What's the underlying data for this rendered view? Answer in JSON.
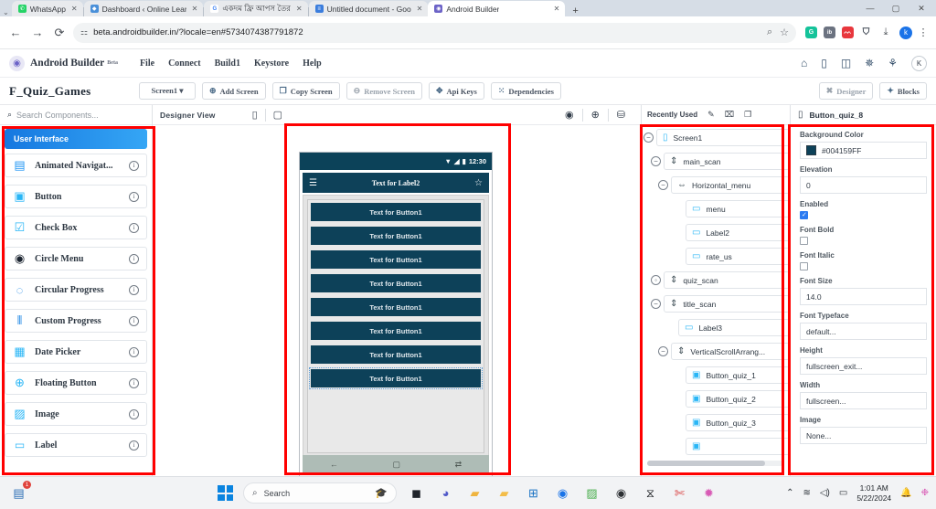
{
  "browser": {
    "tabs": [
      {
        "title": "WhatsApp",
        "favicon": "whatsapp-icon",
        "color": "#25d366",
        "glyph": "✆",
        "active": false
      },
      {
        "title": "Dashboard ‹ Online Learn",
        "favicon": "wordpress-icon",
        "color": "#4a90d9",
        "glyph": "◆",
        "active": false
      },
      {
        "title": "একদম ফ্রি আপস তৈর",
        "favicon": "google-icon",
        "color": "#ffffff",
        "glyph": "G",
        "active": false
      },
      {
        "title": "Untitled document - Goo",
        "favicon": "google-docs-icon",
        "color": "#3b7ddd",
        "glyph": "≡",
        "active": false
      },
      {
        "title": "Android Builder",
        "favicon": "android-builder-icon",
        "color": "#6c63c7",
        "glyph": "◉",
        "active": true
      }
    ],
    "new_tab_label": "+",
    "close_label": "✕",
    "window_controls": {
      "minimize": "—",
      "maximize": "▢",
      "close": "✕"
    },
    "nav": {
      "back": "←",
      "forward": "→",
      "reload": "⟳"
    },
    "url": "beta.androidbuilder.in/?locale=en#5734074387791872",
    "site_icon": "site-settings-icon",
    "zoom_icon": "zoom-icon",
    "bookmark_icon": "star-icon",
    "extensions": [
      {
        "name": "grammarly-extension",
        "glyph": "G",
        "color": "#15c39a"
      },
      {
        "name": "ib-extension",
        "glyph": "ib",
        "color": "#6b7280"
      },
      {
        "name": "chart-extension",
        "glyph": "ᨓ",
        "color": "#e8373d"
      },
      {
        "name": "pocket-extension",
        "glyph": "⛉",
        "color": "#3c4450"
      }
    ],
    "download_icon": "download-icon",
    "profile_initial": "k",
    "menu_icon": "kebab-menu-icon"
  },
  "app": {
    "brand": "Android Builder",
    "brand_badge": "Beta",
    "menu": [
      "File",
      "Connect",
      "Build1",
      "Keystore",
      "Help"
    ],
    "right_icons": [
      {
        "name": "home-icon",
        "glyph": "⌂"
      },
      {
        "name": "phone-icon",
        "glyph": "▯"
      },
      {
        "name": "book-icon",
        "glyph": "◫"
      },
      {
        "name": "bug-icon",
        "glyph": "✵"
      },
      {
        "name": "community-icon",
        "glyph": "⚘"
      }
    ],
    "avatar_initial": "K"
  },
  "toolbar": {
    "project_name": "F_Quiz_Games",
    "screen_selector": "Screen1 ▾",
    "buttons": [
      {
        "label": "Add Screen",
        "icon": "plus-circle-icon",
        "glyph": "⊕",
        "muted": false
      },
      {
        "label": "Copy Screen",
        "icon": "copy-icon",
        "glyph": "❐",
        "muted": false
      },
      {
        "label": "Remove Screen",
        "icon": "minus-circle-icon",
        "glyph": "⊖",
        "muted": true
      },
      {
        "label": "Api Keys",
        "icon": "key-icon",
        "glyph": "✥",
        "muted": false
      },
      {
        "label": "Dependencies",
        "icon": "dependencies-icon",
        "glyph": "⁙",
        "muted": false
      }
    ],
    "right_buttons": [
      {
        "label": "Designer",
        "icon": "designer-icon",
        "glyph": "✖",
        "muted": true
      },
      {
        "label": "Blocks",
        "icon": "blocks-icon",
        "glyph": "✦",
        "muted": false
      }
    ]
  },
  "palette": {
    "search_placeholder": "Search Components...",
    "search_icon": "search-icon",
    "category": "User Interface",
    "components": [
      {
        "label": "Animated Navigat...",
        "icon": "animated-navigation-icon",
        "glyph": "▤",
        "color": "#2196f3"
      },
      {
        "label": "Button",
        "icon": "button-icon",
        "glyph": "▢",
        "color": "#29b6f6"
      },
      {
        "label": "Check Box",
        "icon": "checkbox-icon",
        "glyph": "☑",
        "color": "#29b6f6"
      },
      {
        "label": "Circle Menu",
        "icon": "circle-menu-icon",
        "glyph": "◉",
        "color": "#1b2430"
      },
      {
        "label": "Circular Progress",
        "icon": "circular-progress-icon",
        "glyph": "◌",
        "color": "#1e88e5"
      },
      {
        "label": "Custom Progress",
        "icon": "custom-progress-icon",
        "glyph": "⦀",
        "color": "#1e88e5"
      },
      {
        "label": "Date Picker",
        "icon": "date-picker-icon",
        "glyph": "▣",
        "color": "#29b6f6"
      },
      {
        "label": "Floating Button",
        "icon": "floating-button-icon",
        "glyph": "⊕",
        "color": "#29b6f6"
      },
      {
        "label": "Image",
        "icon": "image-icon",
        "glyph": "▨",
        "color": "#29b6f6"
      },
      {
        "label": "Label",
        "icon": "label-icon",
        "glyph": "🏷",
        "color": "#29b6f6"
      }
    ],
    "info_glyph": "i"
  },
  "designer": {
    "view_label": "Designer View",
    "device_toggles": [
      {
        "name": "phone-portrait-toggle",
        "glyph": "▯"
      },
      {
        "name": "tablet-toggle",
        "glyph": "▢"
      }
    ],
    "right_icons": [
      {
        "name": "preview-eye-icon",
        "glyph": "◉"
      },
      {
        "name": "zoom-in-icon",
        "glyph": "⊕"
      },
      {
        "name": "save-snapshot-icon",
        "glyph": "⛁"
      }
    ],
    "phone": {
      "status_time": "12:30",
      "status_icons": [
        {
          "name": "wifi-icon",
          "glyph": "▼"
        },
        {
          "name": "signal-icon",
          "glyph": "◢"
        },
        {
          "name": "battery-icon",
          "glyph": "▮"
        }
      ],
      "title_bar": {
        "menu_icon": "hamburger-menu-icon",
        "menu_glyph": "☰",
        "title": "Text for Label2",
        "action_icon": "star-icon",
        "action_glyph": "☆"
      },
      "buttons": [
        {
          "label": "Text for Button1",
          "selected": false
        },
        {
          "label": "Text for Button1",
          "selected": false
        },
        {
          "label": "Text for Button1",
          "selected": false
        },
        {
          "label": "Text for Button1",
          "selected": false
        },
        {
          "label": "Text for Button1",
          "selected": false
        },
        {
          "label": "Text for Button1",
          "selected": false
        },
        {
          "label": "Text for Button1",
          "selected": false
        },
        {
          "label": "Text for Button1",
          "selected": true
        }
      ],
      "nav_bar": [
        {
          "name": "android-back-icon",
          "glyph": "←"
        },
        {
          "name": "android-home-icon",
          "glyph": "▢"
        },
        {
          "name": "android-recents-icon",
          "glyph": "⇄"
        }
      ]
    }
  },
  "tree": {
    "header_label": "Recently Used",
    "header_icons": [
      {
        "name": "rename-pencil-icon",
        "glyph": "✎"
      },
      {
        "name": "delete-trash-icon",
        "glyph": "🗑"
      },
      {
        "name": "duplicate-icon",
        "glyph": "❐"
      }
    ],
    "nodes": [
      {
        "label": "Screen1",
        "indent": 0,
        "toggle": "⊖",
        "icon": "screen-icon",
        "glyph": "▯",
        "color": "#29b6f6"
      },
      {
        "label": "main_scan",
        "indent": 1,
        "toggle": "⊖",
        "icon": "vertical-arrangement-icon",
        "glyph": "⇕",
        "color": "#37474f"
      },
      {
        "label": "Horizontal_menu",
        "indent": 2,
        "toggle": "⊖",
        "icon": "horizontal-arrangement-icon",
        "glyph": "⇔",
        "color": "#37474f"
      },
      {
        "label": "menu",
        "indent": 3,
        "toggle": "",
        "icon": "label-icon",
        "glyph": "🏷",
        "color": "#29b6f6"
      },
      {
        "label": "Label2",
        "indent": 3,
        "toggle": "",
        "icon": "label-icon",
        "glyph": "🏷",
        "color": "#29b6f6"
      },
      {
        "label": "rate_us",
        "indent": 3,
        "toggle": "",
        "icon": "label-icon",
        "glyph": "🏷",
        "color": "#29b6f6"
      },
      {
        "label": "quiz_scan",
        "indent": 1,
        "toggle": "⊕",
        "icon": "vertical-arrangement-icon",
        "glyph": "⇕",
        "color": "#37474f"
      },
      {
        "label": "title_scan",
        "indent": 1,
        "toggle": "⊖",
        "icon": "vertical-arrangement-icon",
        "glyph": "⇕",
        "color": "#37474f"
      },
      {
        "label": "Label3",
        "indent": 2,
        "toggle": "",
        "icon": "label-icon",
        "glyph": "🏷",
        "color": "#29b6f6"
      },
      {
        "label": "VerticalScrollArrang...",
        "indent": 2,
        "toggle": "⊖",
        "icon": "vertical-scroll-arrangement-icon",
        "glyph": "⇕",
        "color": "#37474f"
      },
      {
        "label": "Button_quiz_1",
        "indent": 3,
        "toggle": "",
        "icon": "button-icon",
        "glyph": "▢",
        "color": "#29b6f6"
      },
      {
        "label": "Button_quiz_2",
        "indent": 3,
        "toggle": "",
        "icon": "button-icon",
        "glyph": "▢",
        "color": "#29b6f6"
      },
      {
        "label": "Button_quiz_3",
        "indent": 3,
        "toggle": "",
        "icon": "button-icon",
        "glyph": "▢",
        "color": "#29b6f6"
      },
      {
        "label": "",
        "indent": 3,
        "toggle": "",
        "icon": "button-icon",
        "glyph": "▢",
        "color": "#29b6f6"
      }
    ]
  },
  "properties": {
    "selected_component": "Button_quiz_8",
    "component_icon": "button-component-icon",
    "component_glyph": "▯",
    "fields": [
      {
        "label": "Background Color",
        "type": "color",
        "value": "#004159FF",
        "swatch": "#0d4159"
      },
      {
        "label": "Elevation",
        "type": "text",
        "value": "0"
      },
      {
        "label": "Enabled",
        "type": "checkbox",
        "checked": true
      },
      {
        "label": "Font Bold",
        "type": "checkbox",
        "checked": false
      },
      {
        "label": "Font Italic",
        "type": "checkbox",
        "checked": false
      },
      {
        "label": "Font Size",
        "type": "text",
        "value": "14.0"
      },
      {
        "label": "Font Typeface",
        "type": "text",
        "value": "default..."
      },
      {
        "label": "Height",
        "type": "text",
        "value": "fullscreen_exit..."
      },
      {
        "label": "Width",
        "type": "text",
        "value": "fullscreen..."
      },
      {
        "label": "Image",
        "type": "text",
        "value": "None..."
      }
    ]
  },
  "taskbar": {
    "search_placeholder": "Search",
    "search_icon": "search-icon",
    "start_icon": "windows-start-icon",
    "pinned": [
      {
        "name": "education-app-icon",
        "glyph": "🎓",
        "color": "#1f2a37"
      },
      {
        "name": "dark-square-app-icon",
        "glyph": "◼",
        "color": "#20242b"
      },
      {
        "name": "microsoft-teams-icon",
        "glyph": "T",
        "color": "#5059c9"
      },
      {
        "name": "file-explorer-icon",
        "glyph": "📁",
        "color": "#f5b942"
      },
      {
        "name": "folder-icon",
        "glyph": "🗂",
        "color": "#f3bd4a"
      },
      {
        "name": "microsoft-store-icon",
        "glyph": "⊞",
        "color": "#1b72c4"
      },
      {
        "name": "google-chrome-icon",
        "glyph": "◉",
        "color": "#1a73e8"
      },
      {
        "name": "photo-editor-icon",
        "glyph": "🖼",
        "color": "#4caf50"
      },
      {
        "name": "obs-studio-icon",
        "glyph": "◉",
        "color": "#2c2f33"
      },
      {
        "name": "capcut-icon",
        "glyph": "✂",
        "color": "#111418"
      },
      {
        "name": "snipping-tool-icon",
        "glyph": "✄",
        "color": "#d93f3f"
      },
      {
        "name": "paint-icon",
        "glyph": "🎨",
        "color": "#d85ab5"
      }
    ],
    "tray_badge_app": {
      "name": "notification-app-icon",
      "glyph": "▤",
      "badge": "1"
    },
    "tray": [
      {
        "name": "show-hidden-icons-chevron",
        "glyph": "⌃"
      },
      {
        "name": "wifi-icon",
        "glyph": "≋"
      },
      {
        "name": "volume-icon",
        "glyph": "🔊"
      },
      {
        "name": "battery-icon",
        "glyph": "▭"
      }
    ],
    "clock_time": "1:01 AM",
    "clock_date": "5/22/2024",
    "notification_icon": "bell-icon",
    "copilot_icon": "copilot-icon"
  }
}
